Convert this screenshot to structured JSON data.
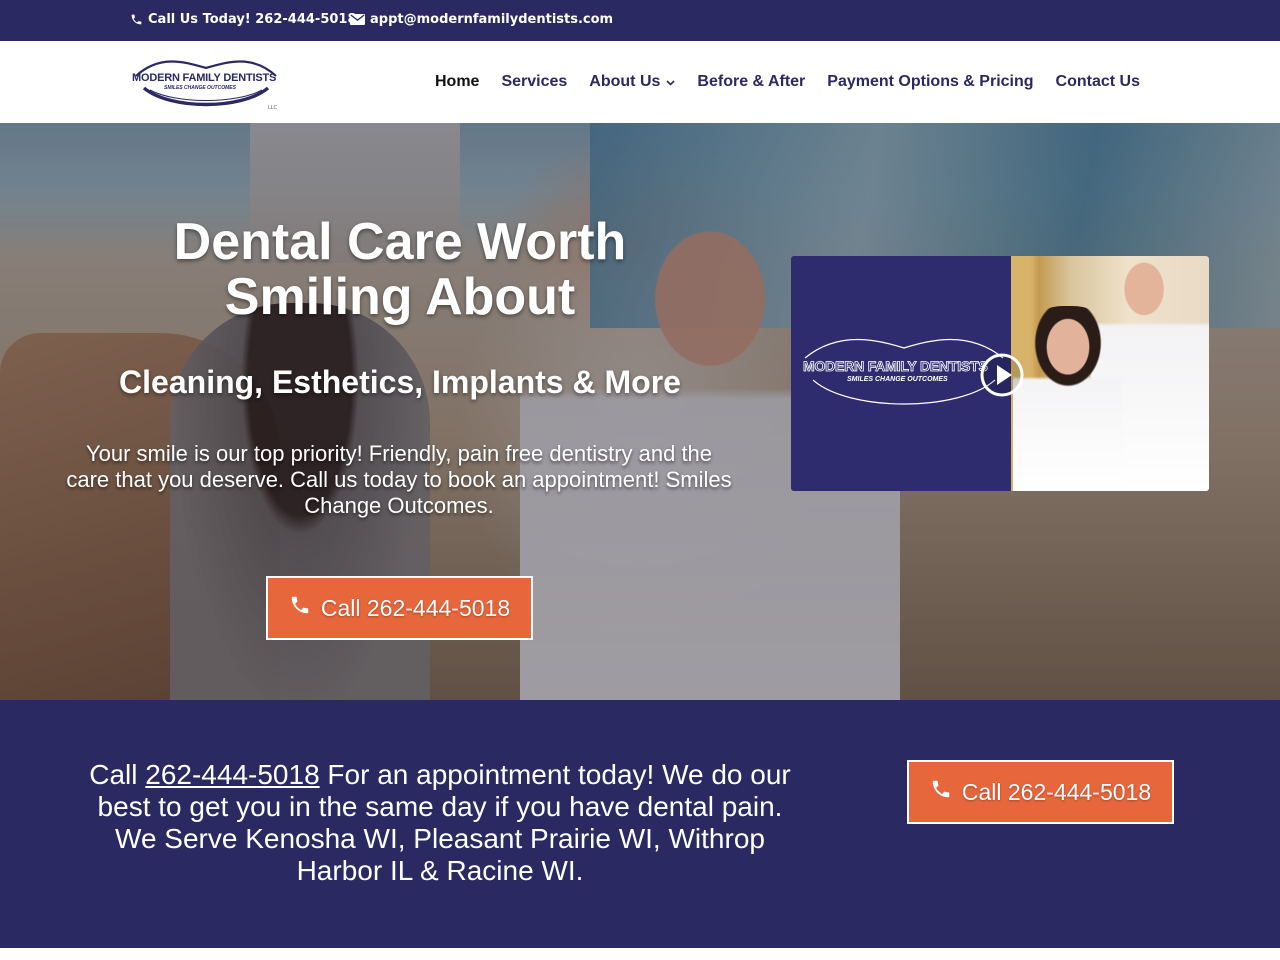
{
  "topbar": {
    "phone_label": "Call Us Today! 262-444-5018",
    "email_label": "appt@modernfamilydentists.com"
  },
  "logo": {
    "title": "MODERN FAMILY DENTISTS",
    "tagline": "SMILES CHANGE OUTCOMES",
    "suffix": "LLC"
  },
  "nav": {
    "items": [
      {
        "label": "Home",
        "active": true
      },
      {
        "label": "Services"
      },
      {
        "label": "About Us",
        "has_dropdown": true
      },
      {
        "label": "Before & After"
      },
      {
        "label": "Payment Options & Pricing"
      },
      {
        "label": "Contact Us"
      }
    ]
  },
  "hero": {
    "title_line1": "Dental Care Worth",
    "title_line2": "Smiling About",
    "subtitle": "Cleaning, Esthetics, Implants & More",
    "description": "Your smile is our top priority! Friendly, pain free dentistry and the care that you deserve. Call us today to book an appointment! Smiles Change Outcomes.",
    "button_label": "Call 262-444-5018"
  },
  "video": {
    "logo_title": "MODERN FAMILY DENTISTS",
    "logo_tagline": "SMILES CHANGE OUTCOMES"
  },
  "cta": {
    "text_prefix": "Call",
    "phone_link": "262-444-5018",
    "text_suffix": "For an appointment today! We do our best to get you in the same day if you have dental pain. We Serve Kenosha WI, Pleasant Prairie WI, Withrop Harbor IL & Racine WI.",
    "button_label": "Call 262-444-5018"
  },
  "colors": {
    "brand_navy": "#2a2961",
    "accent_orange": "#e8663b"
  },
  "icons": {
    "phone": "phone-icon",
    "email": "envelope-icon",
    "play": "play-icon",
    "dropdown": "chevron-down-icon"
  }
}
